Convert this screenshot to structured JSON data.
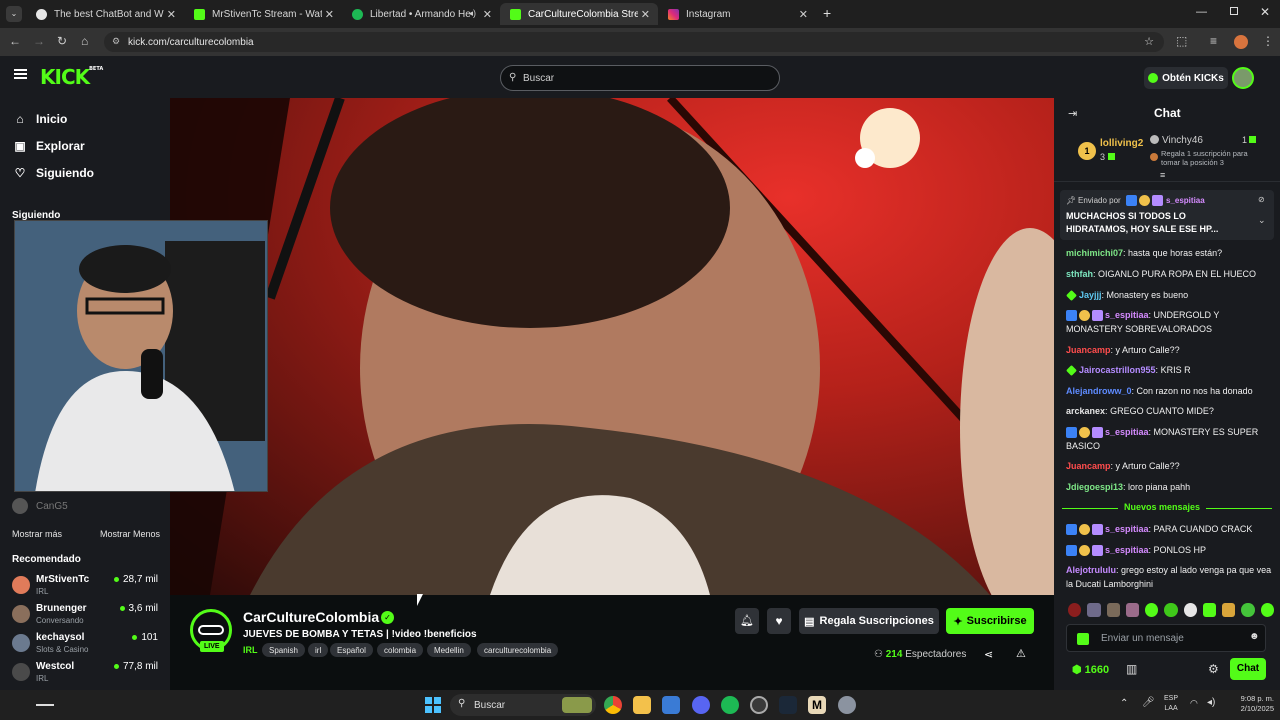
{
  "browser": {
    "tabs": [
      {
        "title": "The best ChatBot and Widgets",
        "fav_color": "#e6e6e6"
      },
      {
        "title": "MrStivenTc Stream - Watch Live",
        "fav_color": "#53fc18"
      },
      {
        "title": "Libertad • Armando Hernan",
        "fav_color": "#1db954"
      },
      {
        "title": "CarCultureColombia Stream - W",
        "fav_color": "#53fc18"
      },
      {
        "title": "Instagram",
        "fav_color": "#e1306c"
      }
    ],
    "url": "kick.com/carculturecolombia",
    "new_tab": "+"
  },
  "header": {
    "logo": "KICK",
    "logo_beta": "BETA",
    "search_placeholder": "Buscar",
    "get_kicks": "Obtén KICKs"
  },
  "sidebar": {
    "nav": [
      {
        "label": "Inicio",
        "icon": "home-icon"
      },
      {
        "label": "Explorar",
        "icon": "compass-icon"
      },
      {
        "label": "Siguiendo",
        "icon": "heart-icon"
      }
    ],
    "following_title": "Siguiendo",
    "following_last": "CanG5",
    "show_more": "Mostrar más",
    "show_less": "Mostrar Menos",
    "recommended_title": "Recomendado",
    "recommended": [
      {
        "name": "MrStivenTc",
        "category": "IRL",
        "viewers": "28,7 mil",
        "color": "#e07b5a"
      },
      {
        "name": "Brunenger",
        "category": "Conversando",
        "viewers": "3,6 mil",
        "color": "#8a6f5c"
      },
      {
        "name": "kechaysol",
        "category": "Slots & Casino",
        "viewers": "101",
        "color": "#6b7a8f"
      },
      {
        "name": "Westcol",
        "category": "IRL",
        "viewers": "77,8 mil",
        "color": "#4a4a4a"
      }
    ]
  },
  "stream": {
    "channel": "CarCultureColombia",
    "live_label": "LIVE",
    "title": "JUEVES DE BOMBA Y TETAS | !video !beneficios",
    "category": "IRL",
    "tags": [
      "Spanish",
      "irl",
      "Español",
      "colombia",
      "Medellin",
      "carculturecolombia"
    ],
    "gift_subs": "Regala Suscripciones",
    "subscribe": "Suscribirse",
    "viewers": "214",
    "viewers_label": "Espectadores"
  },
  "chat": {
    "title": "Chat",
    "leaderboard": {
      "first_name": "lolliving2",
      "first_rank": "1",
      "first_count": "3",
      "second_name": "Vinchy46",
      "second_count": "1",
      "second_note": "Regala 1 suscripción para tomar la posición 3"
    },
    "pinned": {
      "sent_by": "Enviado por",
      "user": "s_espitiaa",
      "text": "MUCHACHOS SI TODOS LO HIDRATAMOS, HOY SALE ESE HP..."
    },
    "messages": [
      {
        "user": "michimichi07",
        "text": "hasta que horas están?",
        "color": "#7ee787"
      },
      {
        "user": "sthfah",
        "text": "OIGANLO PURA ROPA EN EL HUECO",
        "color": "#7ee7c0"
      },
      {
        "user": "Jayjjj",
        "text": "Monastery es bueno",
        "color": "#5ec8f0"
      },
      {
        "user": "s_espitiaa",
        "text": "UNDERGOLD Y MONASTERY SOBREVALORADOS",
        "color": "#d58bff"
      },
      {
        "user": "Juancamp",
        "text": "y Arturo Calle??",
        "color": "#ff4d4d"
      },
      {
        "user": "Jairocastrillon955",
        "text": "KRIS R",
        "color": "#b48cff"
      },
      {
        "user": "Alejandroww_0",
        "text": "Con razon no nos ha donado",
        "color": "#5e8bff"
      },
      {
        "user": "arckanex",
        "text": "GREGO CUANTO MIDE?",
        "color": "#e6e6e6"
      },
      {
        "user": "s_espitiaa",
        "text": "MONASTERY ES SUPER BASICO",
        "color": "#d58bff"
      },
      {
        "user": "Juancamp",
        "text": "y Arturo Calle??",
        "color": "#ff4d4d"
      },
      {
        "user": "Jdiegoespi13",
        "text": "loro piana pahh",
        "color": "#7ee787"
      }
    ],
    "new_messages": "Nuevos mensajes",
    "new_list": [
      {
        "user": "s_espitiaa",
        "text": "PARA CUANDO CRACK",
        "color": "#d58bff"
      },
      {
        "user": "s_espitiaa",
        "text": "PONLOS HP",
        "color": "#d58bff"
      },
      {
        "user": "Alejotrululu",
        "text": "grego estoy al lado venga pa que vea la Ducati Lamborghini",
        "color": "#c58bff"
      }
    ],
    "input_placeholder": "Enviar un mensaje",
    "points": "1660",
    "send": "Chat"
  },
  "taskbar": {
    "search": "Buscar",
    "lang": "ESP",
    "lang2": "LAA",
    "time": "9:08 p. m.",
    "date": "2/10/2025"
  }
}
